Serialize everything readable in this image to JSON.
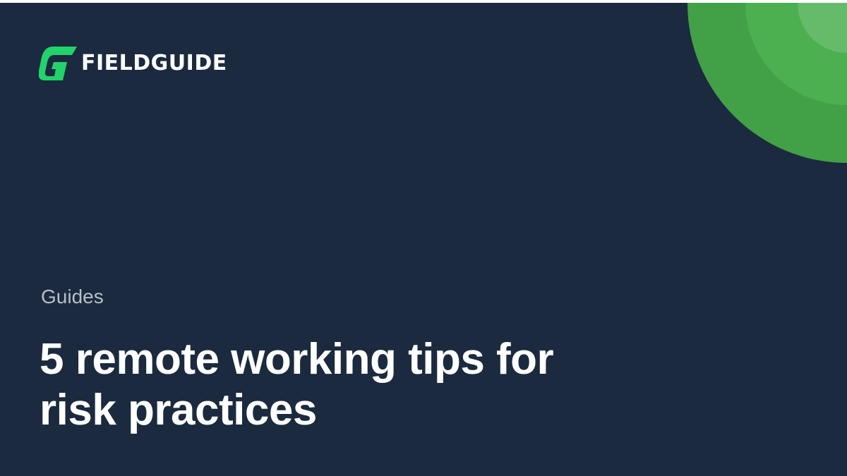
{
  "brand": {
    "name": "FIELDGUIDE",
    "logo_icon": "fieldguide-g-logo-icon"
  },
  "article": {
    "category": "Guides",
    "title_line1": "5 remote working tips for",
    "title_line2": "risk practices"
  },
  "colors": {
    "background": "#1b2a3e",
    "accent_green": "#22d36b",
    "circle_outer": "#42a047",
    "circle_middle": "#4caf50",
    "circle_inner": "#66bb6a",
    "category_text": "#b9bec6",
    "title_text": "#ffffff"
  }
}
